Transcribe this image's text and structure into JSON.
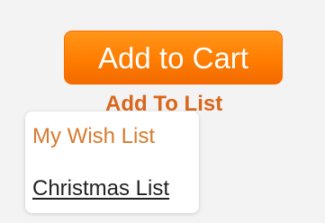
{
  "buttons": {
    "add_to_cart": "Add to Cart",
    "add_to_list": "Add To List"
  },
  "list_menu": {
    "items": [
      {
        "label": "My Wish List"
      },
      {
        "label": "Christmas List"
      }
    ]
  },
  "colors": {
    "page_background": "#f3f3f3",
    "cart_button": "#ff7d00",
    "accent_text": "#d9661a",
    "menu_background": "#ffffff",
    "menu_text_dark": "#222222"
  }
}
